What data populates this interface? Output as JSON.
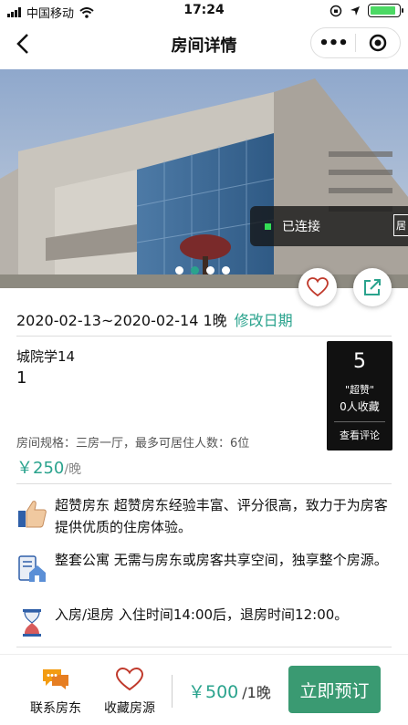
{
  "status_bar": {
    "carrier": "中国移动",
    "time": "17:24",
    "battery_level": 0.9,
    "signal_bars": 4
  },
  "nav": {
    "title": "房间详情",
    "more_label": "•••",
    "icons": [
      "chevron-left-icon",
      "target-icon"
    ]
  },
  "hero": {
    "slide_count": 4,
    "active_slide": 2,
    "connection_status": "已连接",
    "connection_tag": "居"
  },
  "booking": {
    "date_range": "2020-02-13~2020-02-14 1晚",
    "edit_label": "修改日期"
  },
  "room": {
    "name": "城院学14",
    "number": "1",
    "spec": "房间规格：三房一厅，最多可居住人数：6位",
    "price": "￥250",
    "price_unit": "/晚"
  },
  "rating": {
    "score": "5",
    "tag": "\"超赞\"",
    "favorites": "0人收藏",
    "review_label": "查看评论"
  },
  "features": [
    {
      "icon": "thumbs-up-icon",
      "text": "超赞房东 超赞房东经验丰富、评分很高，致力于为房客提供优质的住房体验。"
    },
    {
      "icon": "house-icon",
      "text": "整套公寓 无需与房东或房客共享空间，独享整个房源。"
    },
    {
      "icon": "hourglass-icon",
      "text": "入房/退房 入住时间14:00后，退房时间12:00。"
    }
  ],
  "bottom_bar": {
    "contact_label": "联系房东",
    "favorite_label": "收藏房源",
    "total_price": "￥500",
    "total_unit": "/1晚",
    "book_label": "立即预订"
  },
  "colors": {
    "accent": "#2aa38d",
    "book_button": "#3a9a72",
    "rating_bg": "#111111"
  }
}
